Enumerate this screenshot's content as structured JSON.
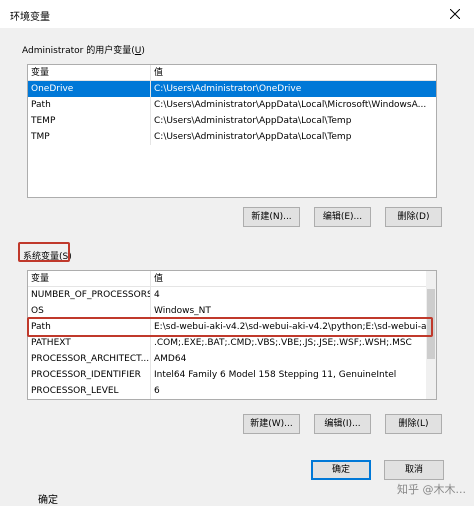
{
  "window": {
    "title": "环境变量",
    "close_glyph": "✕"
  },
  "user_vars": {
    "group_label_prefix": "Administrator 的用户变量(",
    "group_label_key": "U",
    "group_label_suffix": ")",
    "headers": {
      "name": "变量",
      "value": "值"
    },
    "rows": [
      {
        "name": "OneDrive",
        "value": "C:\\Users\\Administrator\\OneDrive"
      },
      {
        "name": "Path",
        "value": "C:\\Users\\Administrator\\AppData\\Local\\Microsoft\\WindowsA..."
      },
      {
        "name": "TEMP",
        "value": "C:\\Users\\Administrator\\AppData\\Local\\Temp"
      },
      {
        "name": "TMP",
        "value": "C:\\Users\\Administrator\\AppData\\Local\\Temp"
      }
    ],
    "buttons": {
      "new": "新建(N)...",
      "edit": "编辑(E)...",
      "delete": "删除(D)"
    }
  },
  "system_vars": {
    "group_label": "系统变量(S)",
    "headers": {
      "name": "变量",
      "value": "值"
    },
    "rows": [
      {
        "name": "NUMBER_OF_PROCESSORS",
        "value": "4"
      },
      {
        "name": "OS",
        "value": "Windows_NT"
      },
      {
        "name": "Path",
        "value": "E:\\sd-webui-aki-v4.2\\sd-webui-aki-v4.2\\python;E:\\sd-webui-a..."
      },
      {
        "name": "PATHEXT",
        "value": ".COM;.EXE;.BAT;.CMD;.VBS;.VBE;.JS;.JSE;.WSF;.WSH;.MSC"
      },
      {
        "name": "PROCESSOR_ARCHITECT...",
        "value": "AMD64"
      },
      {
        "name": "PROCESSOR_IDENTIFIER",
        "value": "Intel64 Family 6 Model 158 Stepping 11, GenuineIntel"
      },
      {
        "name": "PROCESSOR_LEVEL",
        "value": "6"
      }
    ],
    "buttons": {
      "new": "新建(W)...",
      "edit": "编辑(I)...",
      "delete": "删除(L)"
    }
  },
  "dialog_buttons": {
    "ok": "确定",
    "cancel": "取消"
  },
  "watermark": "知乎 @木木...",
  "bottom_text": "确定",
  "colors": {
    "selection": "#0078d7",
    "highlight_box": "#c0392b"
  }
}
